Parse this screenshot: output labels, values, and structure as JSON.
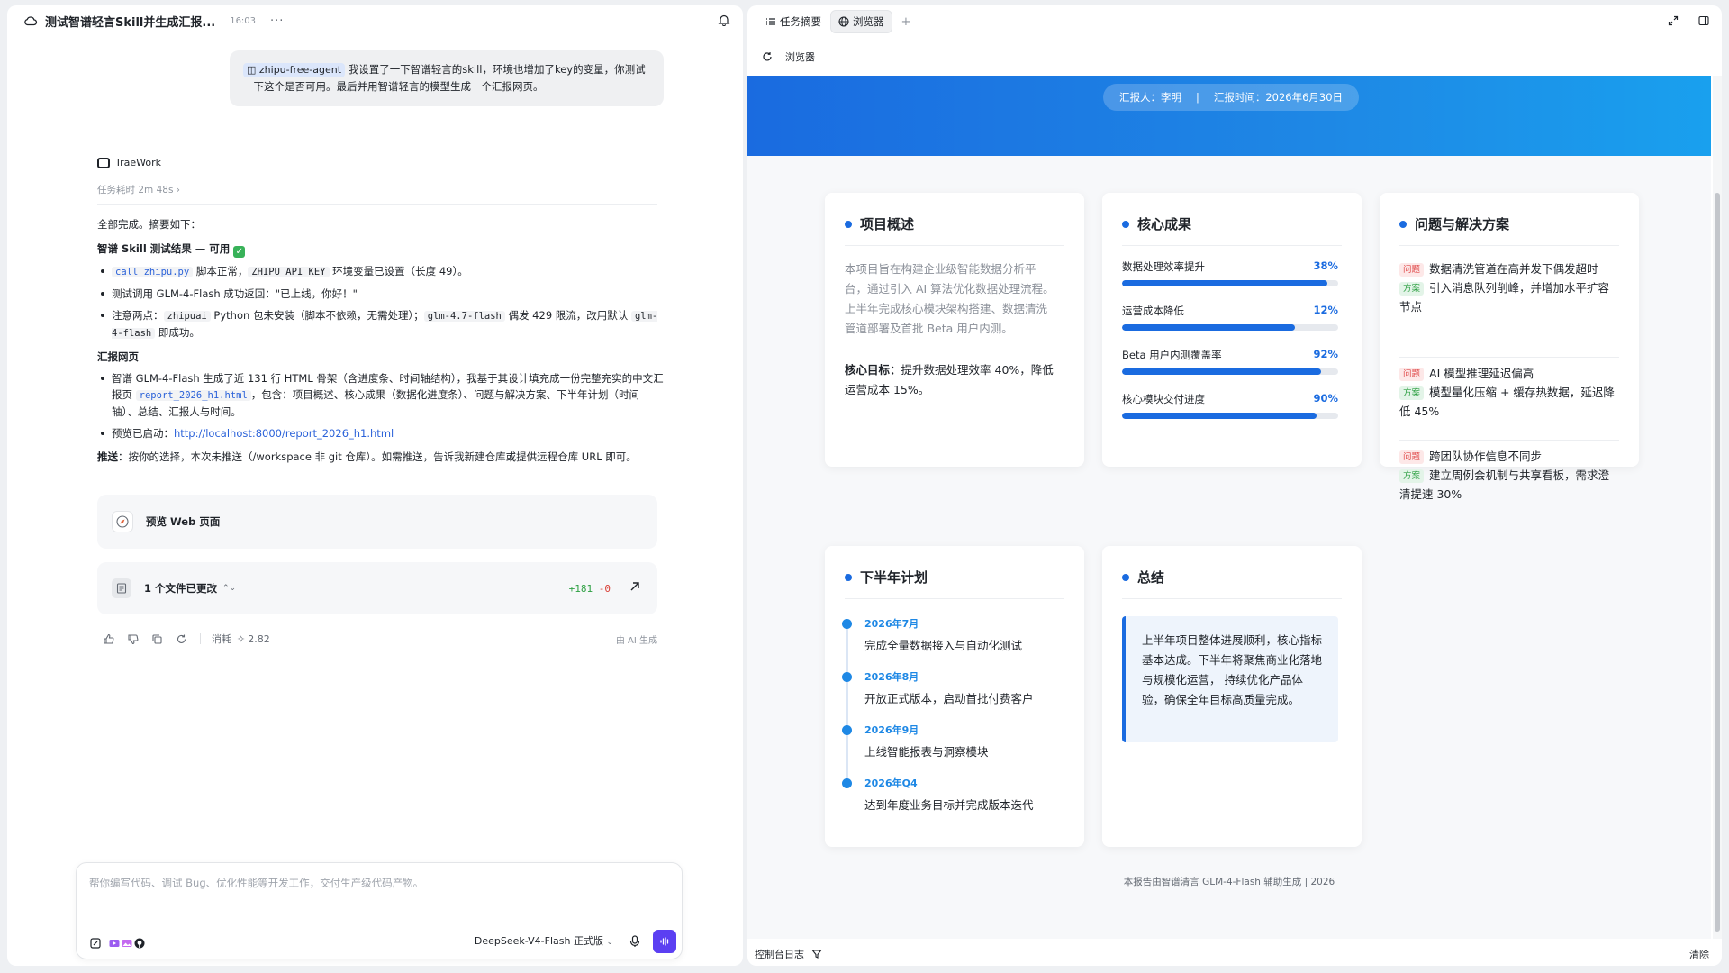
{
  "chat": {
    "title": "测试智谱轻言Skill并生成汇报...",
    "time": "16:03",
    "user_tag": "zhipu-free-agent",
    "user_message": "我设置了一下智谱轻言的skill，环境也增加了key的变量，你测试一下这个是否可用。最后并用智谱轻言的模型生成一个汇报网页。",
    "agent_name": "TraeWork",
    "task_duration": "任务耗时 2m 48s",
    "summary_intro": "全部完成。摘要如下：",
    "section1_title": "智谱 Skill 测试结果 — 可用",
    "bullet1_code1": "call_zhipu.py",
    "bullet1_text1": " 脚本正常，",
    "bullet1_code2": "ZHIPU_API_KEY",
    "bullet1_text2": " 环境变量已设置（长度 49）。",
    "bullet2": "测试调用 GLM-4-Flash 成功返回：\"已上线，你好！\"",
    "bullet3_text1": "注意两点：",
    "bullet3_code1": "zhipuai",
    "bullet3_text2": " Python 包未安装（脚本不依赖，无需处理）；",
    "bullet3_code2": "glm-4.7-flash",
    "bullet3_text3": " 偶发 429 限流，改用默认 ",
    "bullet3_code3": "glm-4-flash",
    "bullet3_text4": " 即成功。",
    "section2_title": "汇报网页",
    "bullet4_text1": "智谱 GLM-4-Flash 生成了近 131 行 HTML 骨架（含进度条、时间轴结构），我基于其设计填充成一份完整充实的中文汇报页 ",
    "bullet4_code": "report_2026_h1.html",
    "bullet4_text2": "，包含：项目概述、核心成果（数据化进度条）、问题与解决方案、下半年计划（时间轴）、总结、汇报人与时间。",
    "bullet5_text": "预览已启动：",
    "bullet5_link": "http://localhost:8000/report_2026_h1.html",
    "push_label": "推送",
    "push_text": "：按你的选择，本次未推送（/workspace 非 git 仓库）。如需推送，告诉我新建仓库或提供远程仓库 URL 即可。",
    "preview_label": "预览 Web 页面",
    "files_changed": "1 个文件已更改",
    "diff_add": "+181",
    "diff_del": "-0",
    "consume_label": "消耗",
    "consume_value": "2.82",
    "ai_generated": "由 AI 生成",
    "composer_placeholder": "帮你编写代码、调试 Bug、优化性能等开发工作，交付生产级代码产物。",
    "model_name": "DeepSeek-V4-Flash 正式版"
  },
  "browser": {
    "tab_summary": "任务摘要",
    "tab_browser": "浏览器",
    "address_label": "浏览器",
    "console_label": "控制台日志",
    "clear_label": "清除"
  },
  "report": {
    "reporter": "汇报人：李明",
    "report_time": "汇报时间：2026年6月30日",
    "overview_title": "项目概述",
    "overview_text": "本项目旨在构建企业级智能数据分析平台，通过引入 AI 算法优化数据处理流程。上半年完成核心模块架构搭建、数据清洗管道部署及首批 Beta 用户内测。",
    "overview_key_label": "核心目标：",
    "overview_key_text": "提升数据处理效率 40%，降低运营成本 15%。",
    "results_title": "核心成果",
    "metrics": [
      {
        "label": "数据处理效率提升",
        "value": "38%",
        "pct": 0.95
      },
      {
        "label": "运营成本降低",
        "value": "12%",
        "pct": 0.8
      },
      {
        "label": "Beta 用户内测覆盖率",
        "value": "92%",
        "pct": 0.92
      },
      {
        "label": "核心模块交付进度",
        "value": "90%",
        "pct": 0.9
      }
    ],
    "issues_title": "问题与解决方案",
    "badge_problem": "问题",
    "badge_solution": "方案",
    "issues": [
      {
        "problem": "数据清洗管道在高并发下偶发超时",
        "solution": "引入消息队列削峰，并增加水平扩容节点"
      },
      {
        "problem": "AI 模型推理延迟偏高",
        "solution": "模型量化压缩 + 缓存热数据，延迟降低 45%"
      },
      {
        "problem": "跨团队协作信息不同步",
        "solution": "建立周例会机制与共享看板，需求澄清提速 30%"
      }
    ],
    "plan_title": "下半年计划",
    "plan": [
      {
        "date": "2026年7月",
        "text": "完成全量数据接入与自动化测试"
      },
      {
        "date": "2026年8月",
        "text": "开放正式版本，启动首批付费客户"
      },
      {
        "date": "2026年9月",
        "text": "上线智能报表与洞察模块"
      },
      {
        "date": "2026年Q4",
        "text": "达到年度业务目标并完成版本迭代"
      }
    ],
    "summary_title": "总结",
    "summary_text": "上半年项目整体进展顺利，核心指标基本达成。下半年将聚焦商业化落地与规模化运营， 持续优化产品体验，确保全年目标高质量完成。",
    "footer": "本报告由智谱清言 GLM-4-Flash 辅助生成 | 2026"
  },
  "colors": {
    "accent": "#1a6be0",
    "send": "#5b3ff2",
    "add": "#2ea043",
    "del": "#d93f36"
  }
}
